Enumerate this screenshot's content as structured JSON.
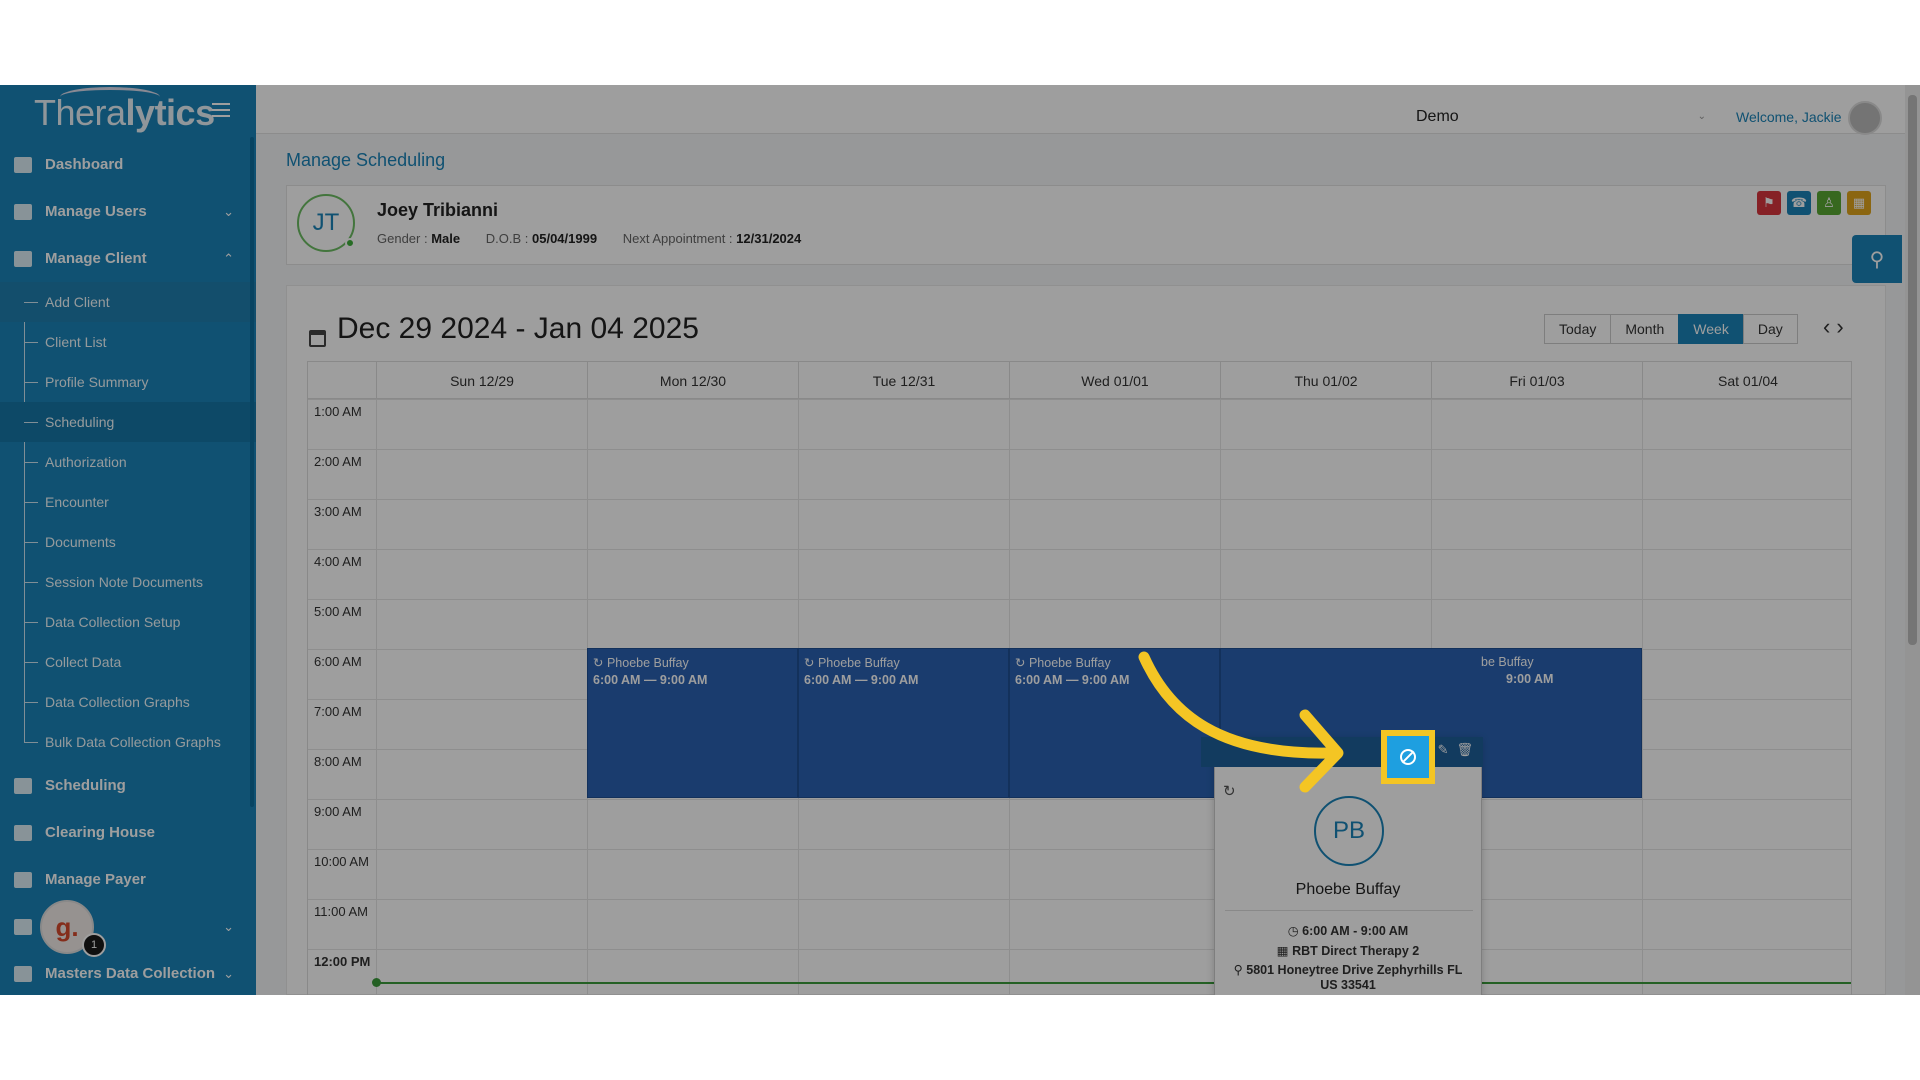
{
  "sidebar": {
    "logo": {
      "light": "Thera",
      "bold": "lytics"
    },
    "items": [
      {
        "label": "Dashboard"
      },
      {
        "label": "Manage Users"
      },
      {
        "label": "Manage Client"
      }
    ],
    "sub_items": [
      {
        "label": "Add Client"
      },
      {
        "label": "Client List"
      },
      {
        "label": "Profile Summary"
      },
      {
        "label": "Scheduling"
      },
      {
        "label": "Authorization"
      },
      {
        "label": "Encounter"
      },
      {
        "label": "Documents"
      },
      {
        "label": "Session Note Documents"
      },
      {
        "label": "Data Collection Setup"
      },
      {
        "label": "Collect Data"
      },
      {
        "label": "Data Collection Graphs"
      },
      {
        "label": "Bulk Data Collection Graphs"
      }
    ],
    "bottom_items": [
      {
        "label": "Scheduling"
      },
      {
        "label": "Clearing House"
      },
      {
        "label": "Manage Payer"
      },
      {
        "label": ""
      },
      {
        "label": "Masters Data Collection"
      }
    ],
    "help_badge": {
      "letter": "g.",
      "count": "1"
    }
  },
  "topbar": {
    "tenant": "Demo",
    "welcome": "Welcome, Jackie"
  },
  "page_title": "Manage Scheduling",
  "client": {
    "initials": "JT",
    "name": "Joey Tribianni",
    "gender_label": "Gender :",
    "gender": "Male",
    "dob_label": "D.O.B :",
    "dob": "05/04/1999",
    "next_label": "Next Appointment :",
    "next": "12/31/2024"
  },
  "calendar": {
    "range_title": "Dec 29 2024 - Jan 04 2025",
    "views": [
      "Today",
      "Month",
      "Week",
      "Day"
    ],
    "active_view": "Week",
    "days": [
      "Sun 12/29",
      "Mon 12/30",
      "Tue 12/31",
      "Wed 01/01",
      "Thu 01/02",
      "Fri 01/03",
      "Sat 01/04"
    ],
    "times": [
      "1:00 AM",
      "2:00 AM",
      "3:00 AM",
      "4:00 AM",
      "5:00 AM",
      "6:00 AM",
      "7:00 AM",
      "8:00 AM",
      "9:00 AM",
      "10:00 AM",
      "11:00 AM",
      "12:00 PM"
    ],
    "events": [
      {
        "name": "Phoebe Buffay",
        "time": "6:00 AM — 9:00 AM"
      },
      {
        "name": "Phoebe Buffay",
        "time": "6:00 AM — 9:00 AM"
      },
      {
        "name": "Phoebe Buffay",
        "time": "6:00 AM — 9:00 AM"
      },
      {
        "name": "be Buffay",
        "time": "9:00 AM"
      }
    ]
  },
  "popup": {
    "initials": "PB",
    "name": "Phoebe Buffay",
    "time": "6:00 AM - 9:00 AM",
    "service": "RBT Direct Therapy 2",
    "address": "5801 Honeytree Drive Zephyrhills FL US 33541"
  },
  "colors": {
    "primary": "#1a84b8",
    "event": "#2a62b2",
    "highlight": "#f4c524"
  }
}
